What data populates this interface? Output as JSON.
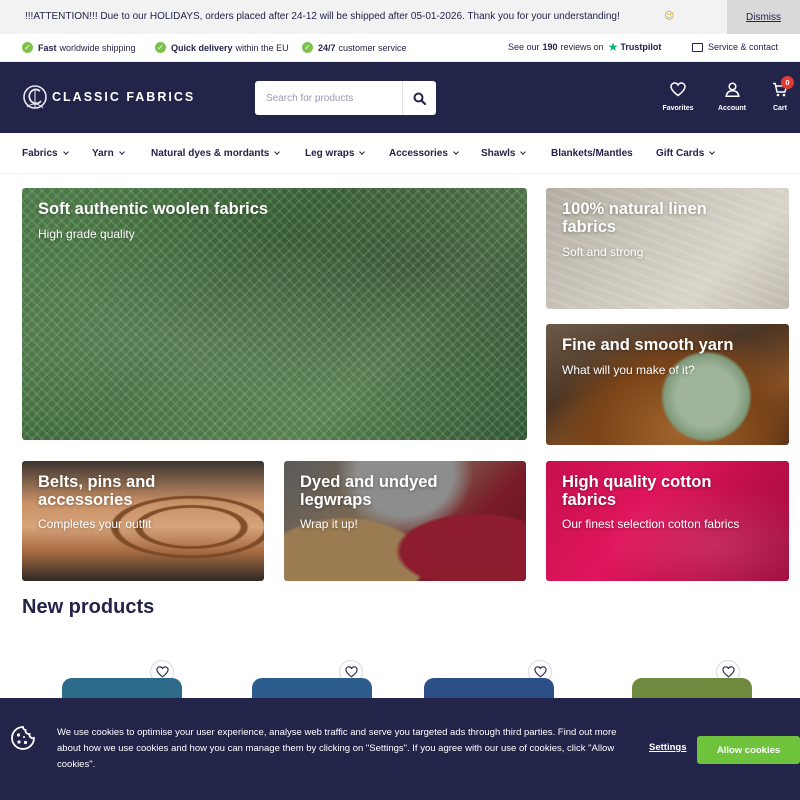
{
  "announcement": {
    "text": "!!!ATTENTION!!! Due to our HOLIDAYS, orders placed after 24-12 will be shipped after 05-01-2026. Thank you for your understanding!",
    "emoji": "😉",
    "dismiss_label": "Dismiss"
  },
  "usp": {
    "items": [
      {
        "bold": "Fast",
        "text": "worldwide shipping"
      },
      {
        "bold": "Quick delivery",
        "text": "within the EU"
      },
      {
        "bold": "24/7",
        "text": "customer service"
      }
    ],
    "reviews": {
      "prefix": "See our",
      "count": "190",
      "suffix": "reviews on",
      "provider": "Trustpilot"
    },
    "service_label": "Service & contact"
  },
  "header": {
    "logo_text": "CLASSIC FABRICS",
    "search_placeholder": "Search for products",
    "favorites_label": "Favorites",
    "account_label": "Account",
    "cart_label": "Cart",
    "cart_count": "0"
  },
  "nav": {
    "items": [
      {
        "label": "Fabrics"
      },
      {
        "label": "Yarn"
      },
      {
        "label": "Natural dyes & mordants"
      },
      {
        "label": "Leg wraps"
      },
      {
        "label": "Accessories"
      },
      {
        "label": "Shawls"
      },
      {
        "label": "Blankets/Mantles"
      },
      {
        "label": "Gift Cards"
      }
    ]
  },
  "tiles": [
    {
      "title": "Soft authentic woolen fabrics",
      "subtitle": "High grade quality"
    },
    {
      "title": "100% natural linen fabrics",
      "subtitle": "Soft and strong"
    },
    {
      "title": "Fine and smooth yarn",
      "subtitle": "What will you make of it?"
    },
    {
      "title": "Belts, pins and accessories",
      "subtitle": "Completes your outfit"
    },
    {
      "title": "Dyed and undyed legwraps",
      "subtitle": "Wrap it up!"
    },
    {
      "title": "High quality cotton fabrics",
      "subtitle": "Our finest selection cotton fabrics"
    }
  ],
  "new_products": {
    "title": "New products"
  },
  "cookie": {
    "text": "We use cookies to optimise your user experience, analyse web traffic and serve you targeted ads through third parties. Find out more about how we use cookies and how you can manage them by clicking on \"Settings\". If you agree with our use of cookies, click \"Allow cookies\".",
    "settings_label": "Settings",
    "allow_label": "Allow cookies"
  },
  "colors": {
    "brand_navy": "#23244a",
    "check_green": "#7cc24a",
    "trustpilot_green": "#00b67a",
    "allow_green": "#6ec23c",
    "cart_badge_red": "#e53935"
  }
}
